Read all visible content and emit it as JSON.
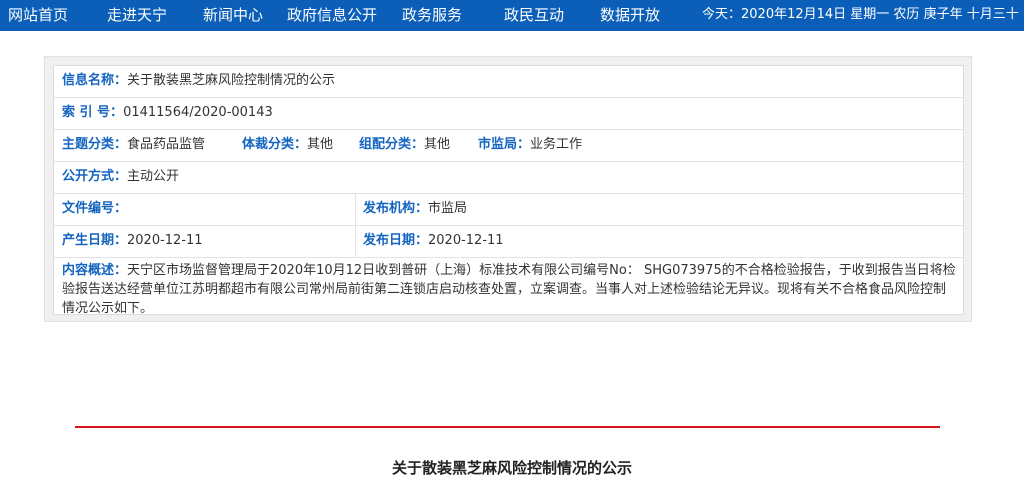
{
  "nav": {
    "items": [
      "网站首页",
      "走进天宁",
      "新闻中心",
      "政府信息公开",
      "政务服务",
      "政民互动",
      "数据开放"
    ],
    "date_text": "今天：2020年12月14日 星期一 农历 庚子年 十月三十"
  },
  "info": {
    "name_label": "信息名称：",
    "name_value": "关于散装黑芝麻风险控制情况的公示",
    "index_label": "索 引 号：",
    "index_value": "01411564/2020-00143",
    "topic_label": "主题分类：",
    "topic_value": "食品药品监管",
    "genre_label": "体裁分类：",
    "genre_value": "其他",
    "org_cat_label": "组配分类：",
    "org_cat_value": "其他",
    "bureau_label": "市监局：",
    "bureau_value": "业务工作",
    "method_label": "公开方式：",
    "method_value": "主动公开",
    "docno_label": "文件编号：",
    "docno_value": "",
    "publisher_label": "发布机构：",
    "publisher_value": "市监局",
    "created_label": "产生日期：",
    "created_value": "2020-12-11",
    "pubdate_label": "发布日期：",
    "pubdate_value": "2020-12-11",
    "summary_label": "内容概述：",
    "summary_value": "天宁区市场监督管理局于2020年10月12日收到普研（上海）标准技术有限公司编号No： SHG073975的不合格检验报告，于收到报告当日将检验报告送达经营单位江苏明都超市有限公司常州局前街第二连锁店启动核查处置，立案调查。当事人对上述检验结论无异议。现将有关不合格食品风险控制情况公示如下。"
  },
  "article": {
    "title": "关于散装黑芝麻风险控制情况的公示",
    "divider_color": "#d4151a"
  }
}
